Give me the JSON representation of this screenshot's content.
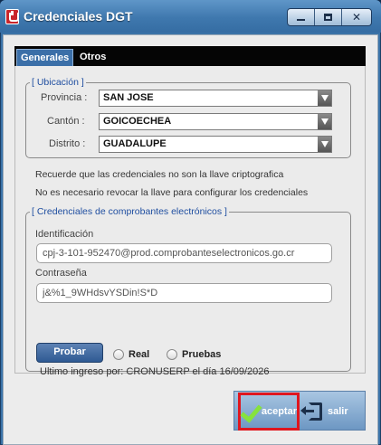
{
  "window": {
    "title": "Credenciales DGT"
  },
  "tabs": [
    {
      "label": "Generales",
      "active": true
    },
    {
      "label": "Otros",
      "active": false
    }
  ],
  "ubicacion": {
    "legend": "[ Ubicación ]",
    "provincia": {
      "label": "Provincia :",
      "value": "SAN JOSE"
    },
    "canton": {
      "label": "Cantón :",
      "value": "GOICOECHEA"
    },
    "distrito": {
      "label": "Distrito :",
      "value": "GUADALUPE"
    }
  },
  "notes": [
    "Recuerde que las credenciales no son la llave criptografica",
    "No es necesario revocar la llave para configurar los credenciales"
  ],
  "credenciales": {
    "legend": "[ Credenciales de comprobantes electrónicos ]",
    "identificacion_label": "Identificación",
    "identificacion_value": "cpj-3-101-952470@prod.comprobanteselectronicos.go.cr",
    "contrasena_label": "Contraseña",
    "contrasena_value": "j&%1_9WHdsvYSDin!S*D",
    "probar_label": "Probar",
    "radio_real": "Real",
    "radio_pruebas": "Pruebas"
  },
  "last_login": "Ultimo ingreso por: CRONUSERP el día 16/09/2026",
  "actions": {
    "accept_label": "aceptar",
    "exit_label": "salir"
  },
  "colors": {
    "title_bar": "#3f78ae",
    "legend_text": "#1f4ea0",
    "accept_highlight": "#e0161f",
    "check": "#86e23c"
  }
}
